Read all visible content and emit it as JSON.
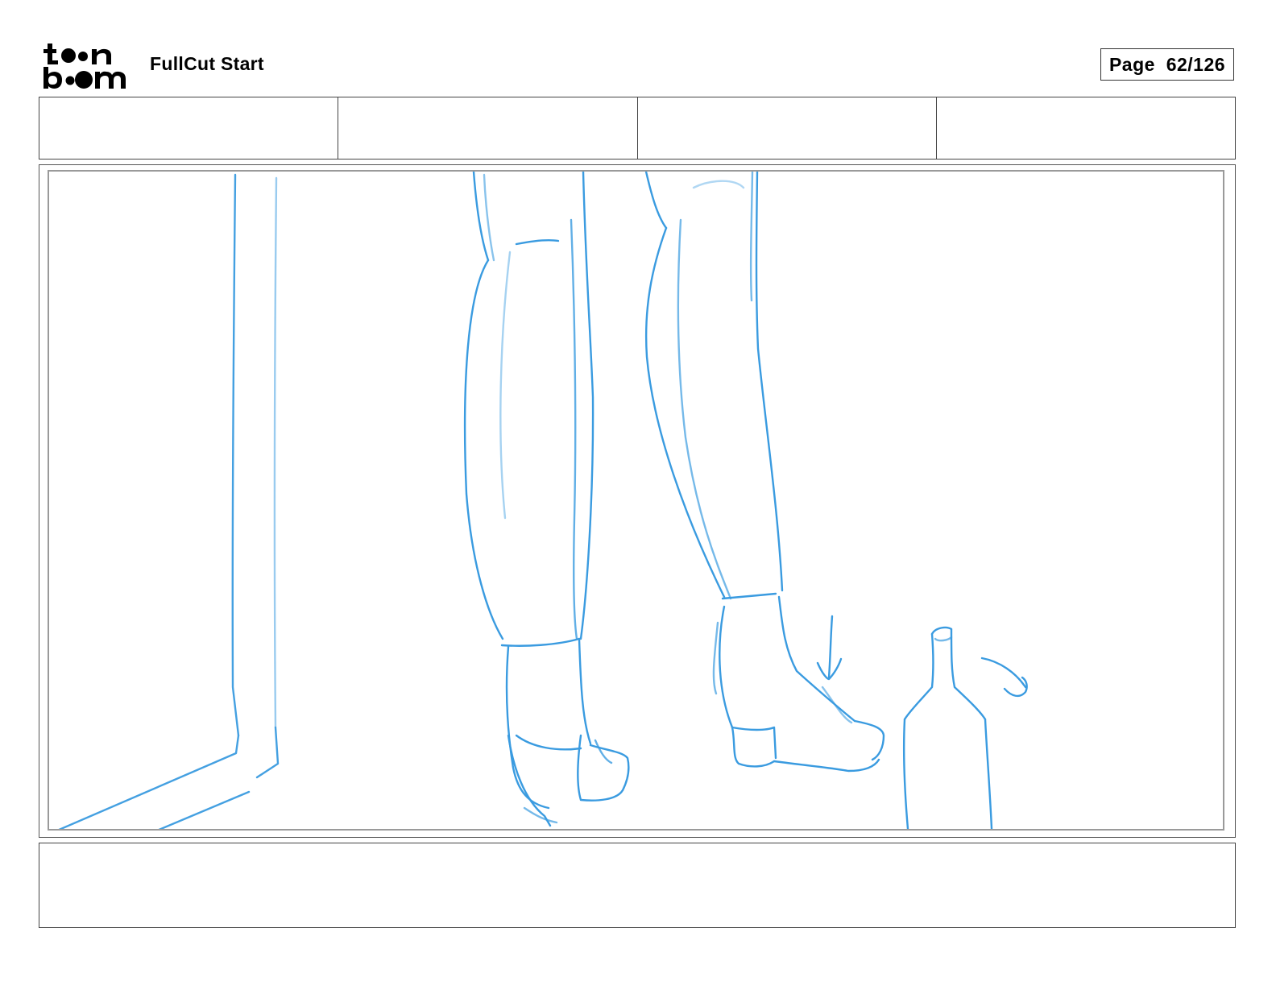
{
  "header": {
    "logo_label": "toon boom",
    "project_title": "FullCut Start",
    "page_indicator": "Page  62/126"
  },
  "info_row": {
    "cells": [
      "",
      "",
      "",
      ""
    ]
  },
  "panel": {
    "sketch_color": "#3a9be0",
    "sketch_elements": [
      "door-frame",
      "leg-left",
      "boot-left",
      "leg-right",
      "boot-right",
      "motion-arrow",
      "bottle",
      "motion-lines"
    ]
  },
  "caption": {
    "text": ""
  }
}
